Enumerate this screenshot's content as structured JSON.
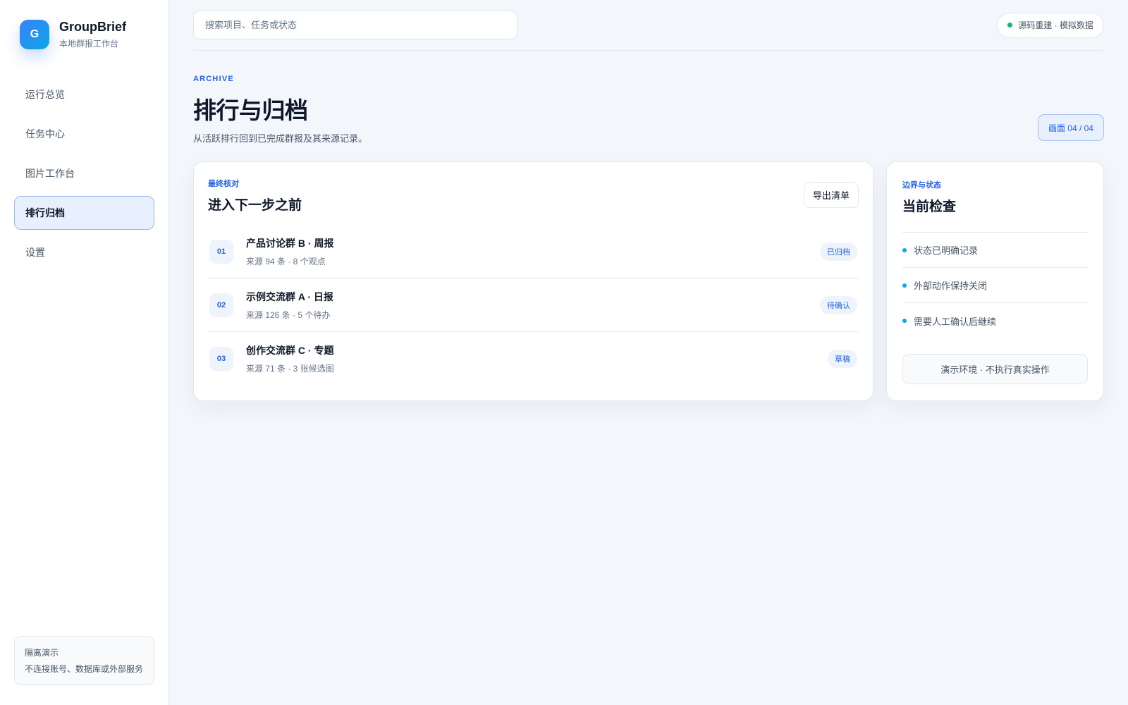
{
  "brand": {
    "logo_letter": "G",
    "name": "GroupBrief",
    "subtitle": "本地群报工作台"
  },
  "sidebar": {
    "items": [
      {
        "label": "运行总览",
        "active": false
      },
      {
        "label": "任务中心",
        "active": false
      },
      {
        "label": "图片工作台",
        "active": false
      },
      {
        "label": "排行归档",
        "active": true
      },
      {
        "label": "设置",
        "active": false
      }
    ],
    "footer": {
      "title": "隔离演示",
      "desc": "不连接账号、数据库或外部服务"
    }
  },
  "topbar": {
    "search_placeholder": "搜索项目、任务或状态",
    "status_text": "源码重建 · 模拟数据",
    "status_color": "#10b981"
  },
  "header": {
    "eyebrow": "ARCHIVE",
    "title": "排行与归档",
    "desc": "从活跃排行回到已完成群报及其来源记录。",
    "screen_badge": "画面 04 / 04"
  },
  "main_card": {
    "eyebrow": "最终核对",
    "title": "进入下一步之前",
    "export_label": "导出清单",
    "rows": [
      {
        "num": "01",
        "title": "产品讨论群 B · 周报",
        "meta": "来源 94 条 · 8 个观点",
        "tag": "已归档"
      },
      {
        "num": "02",
        "title": "示例交流群 A · 日报",
        "meta": "来源 126 条 · 5 个待办",
        "tag": "待确认"
      },
      {
        "num": "03",
        "title": "创作交流群 C · 专题",
        "meta": "来源 71 条 · 3 张候选图",
        "tag": "草稿"
      }
    ]
  },
  "side_card": {
    "eyebrow": "边界与状态",
    "title": "当前检查",
    "checks": [
      "状态已明确记录",
      "外部动作保持关闭",
      "需要人工确认后继续"
    ],
    "demo_label": "演示环境 · 不执行真实操作"
  },
  "colors": {
    "accent": "#2563eb",
    "dot": "#0ea5e9",
    "background": "#f3f6fb"
  }
}
